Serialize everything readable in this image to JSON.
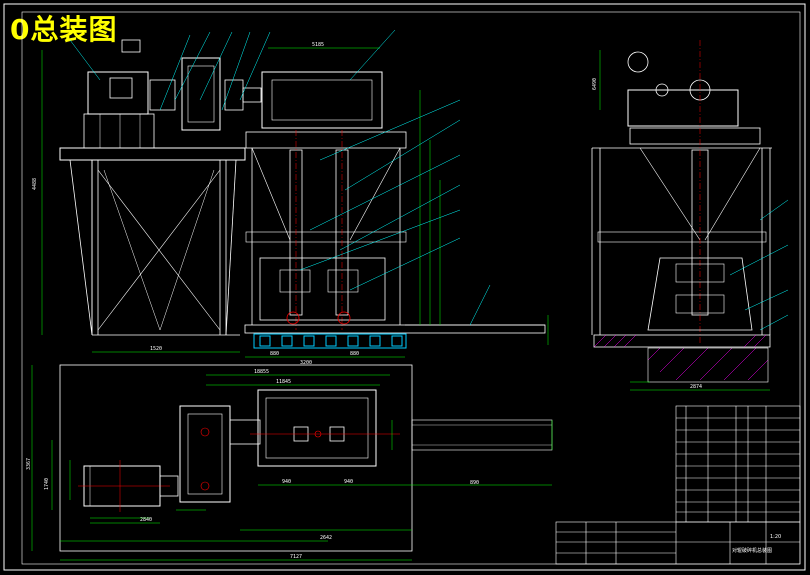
{
  "title": "0总装图",
  "colors": {
    "background": "#000000",
    "frame": "#ffffff",
    "structure": "#ffffff",
    "dimension": "#00ff00",
    "leader": "#00ffff",
    "centerline": "#ff0000",
    "title_text": "#ffff00",
    "hatch": "#ff00ff",
    "bluepart": "#00ccff"
  },
  "dimensions": {
    "front_width_top": "5185",
    "front_height_total": "4488",
    "front_base_left": "1520",
    "front_roll_gap": "880",
    "front_roll_gap2": "880",
    "front_total_width": "3200",
    "plan_total": "7127",
    "plan_motor_len": "2642",
    "plan_gear": "2840",
    "plan_mid_a": "11845",
    "plan_mid_b": "18855",
    "plan_940a": "940",
    "plan_940b": "940",
    "plan_890": "890",
    "plan_height": "3367",
    "plan_1740": "1740",
    "side_width": "2874",
    "side_height": "6490"
  },
  "title_block": {
    "drawing_name": "对辊破碎机总装图",
    "scale": "1:20"
  }
}
